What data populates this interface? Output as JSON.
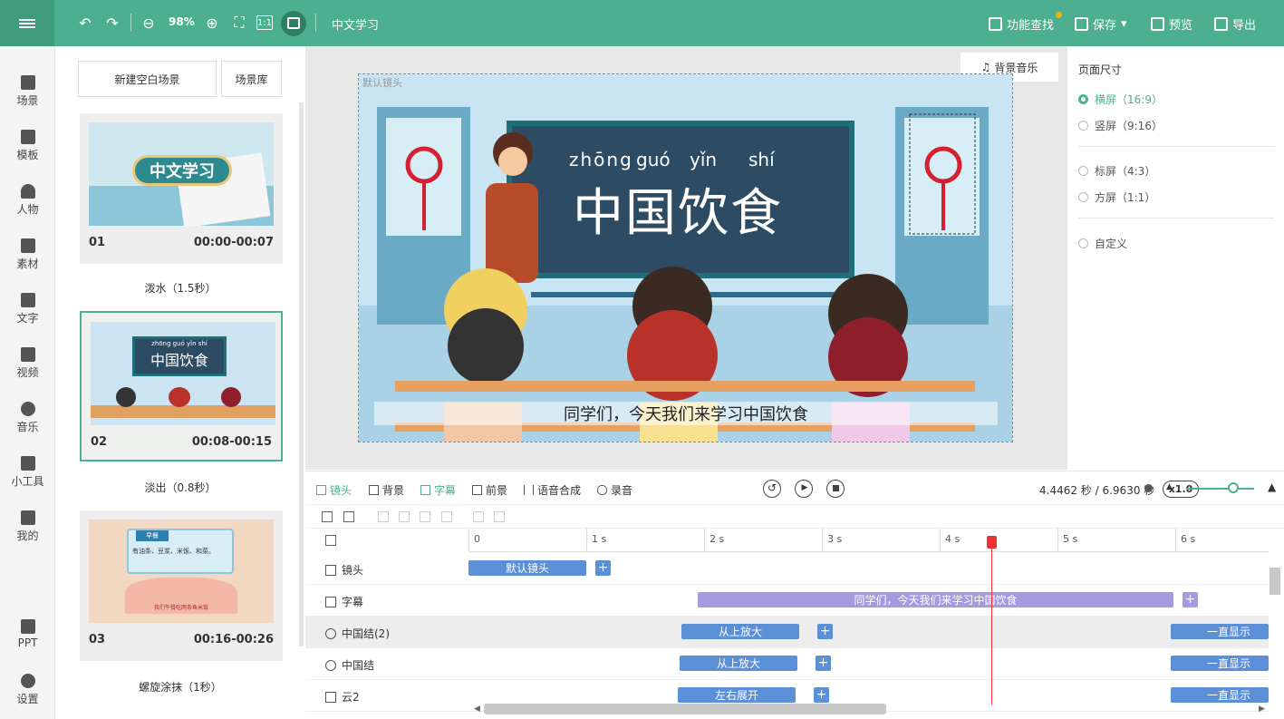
{
  "toolbar": {
    "zoom": "98%",
    "title": "中文学习",
    "feature_search": "功能查找",
    "save": "保存",
    "preview": "预览",
    "export": "导出"
  },
  "iconbar": [
    "场景",
    "模板",
    "人物",
    "素材",
    "文字",
    "视频",
    "音乐",
    "小工具",
    "我的",
    "PPT",
    "设置"
  ],
  "scenes": {
    "new_blank": "新建空白场景",
    "library": "场景库",
    "cards": [
      {
        "num": "01",
        "time": "00:00-00:07",
        "transition": "泼水（1.5秒）",
        "thumb_title": "中文学习"
      },
      {
        "num": "02",
        "time": "00:08-00:15",
        "transition": "淡出（0.8秒）",
        "thumb_title": "中国饮食",
        "thumb_pinyin": "zhōng guó yǐn shí"
      },
      {
        "num": "03",
        "time": "00:16-00:26",
        "transition": "螺旋涂抹（1秒）",
        "thumb_title": "早餐",
        "thumb_text": "有油条、豆浆、米饭、和菜。",
        "thumb_caption": "我们午餐吃两条鱼米饭"
      }
    ]
  },
  "canvas": {
    "bgm": "背景音乐",
    "lens_label": "默认镜头",
    "pinyin": [
      "zhōng",
      "guó",
      "yǐn",
      "shí"
    ],
    "board_text": "中国饮食",
    "subtitle": "同学们，今天我们来学习中国饮食"
  },
  "page_size": {
    "title": "页面尺寸",
    "options": [
      "横屏（16:9）",
      "竖屏（9:16）",
      "标屏（4:3）",
      "方屏（1:1）",
      "自定义"
    ],
    "selected": 0
  },
  "bottom": {
    "tabs": [
      "镜头",
      "背景",
      "字幕",
      "前景",
      "语音合成",
      "录音"
    ],
    "speed": "x1.0",
    "time": "4.4462 秒 / 6.9630 秒"
  },
  "timeline": {
    "ticks": [
      "0",
      "1 s",
      "2 s",
      "3 s",
      "4 s",
      "5 s",
      "6 s"
    ],
    "rows": [
      {
        "name": "镜头",
        "clips": [
          "默认镜头"
        ]
      },
      {
        "name": "字幕",
        "clips": [
          "同学们，今天我们来学习中国饮食"
        ]
      },
      {
        "name": "中国结(2)",
        "clips": [
          "从上放大",
          "一直显示"
        ]
      },
      {
        "name": "中国结",
        "clips": [
          "从上放大",
          "一直显示"
        ]
      },
      {
        "name": "云2",
        "clips": [
          "左右展开",
          "一直显示"
        ]
      }
    ],
    "playhead_seconds": 4.4462
  },
  "colors": {
    "brand": "#4caf8f",
    "clip_blue": "#5b8fd6",
    "clip_purple": "#a59ae0",
    "playhead": "#e33333"
  }
}
